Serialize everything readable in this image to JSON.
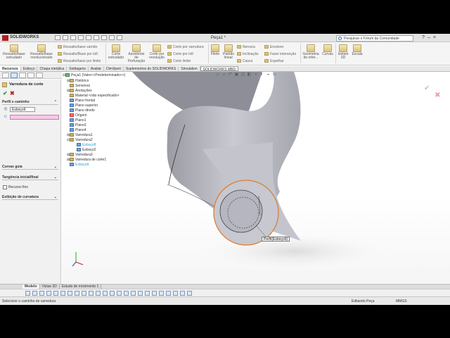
{
  "app": {
    "brand": "SOLIDWORKS",
    "brand_prefix": "3DS",
    "doc_title": "Peça1 *",
    "search_placeholder": "Pesquisar o Fórum da Comunidade"
  },
  "ribbon": {
    "big_buttons": [
      {
        "label": "Ressalto/base extrudado"
      },
      {
        "label": "Ressalto/base revolucionado"
      },
      {
        "label": "Corte extrudado"
      },
      {
        "label": "Assistente de Perfuração"
      },
      {
        "label": "Corte por revolução"
      },
      {
        "label": "Filete"
      },
      {
        "label": "Padrão linear"
      },
      {
        "label": "Nervura"
      },
      {
        "label": "Geometria de refer..."
      },
      {
        "label": "Curvas"
      },
      {
        "label": "Instant 3D"
      },
      {
        "label": "Escala"
      }
    ],
    "small_buttons": [
      {
        "label": "Ressalto/base varrido"
      },
      {
        "label": "Ressalto/Base por loft"
      },
      {
        "label": "Ressalto/base por limite"
      },
      {
        "label": "Corte por varredura"
      },
      {
        "label": "Corte por loft"
      },
      {
        "label": "Corte limite"
      },
      {
        "label": "Inclinação"
      },
      {
        "label": "Casca"
      },
      {
        "label": "Envolver"
      },
      {
        "label": "Fazer interseção"
      },
      {
        "label": "Espelhar"
      }
    ]
  },
  "command_tabs": [
    "Recursos",
    "Esboço",
    "Chapa metálica",
    "Soldagens",
    "Avaliar",
    "DimXpert",
    "Suplementos do SOLIDWORKS",
    "Simulation",
    "SOLIDWORKS MBD"
  ],
  "property_manager": {
    "title": "Varredura de corte",
    "profile_group": "Perfil e caminho",
    "profile_value": "Esboço9",
    "path_value": "",
    "guide_curves_group": "Curvas guia",
    "tangency_group": "Tangência inicial/final",
    "thin_feature_label": "Recurso fino",
    "curvature_group": "Exibição de curvatura"
  },
  "feature_tree": {
    "root": "Peça1  (Valor<<Predeterminado>>)",
    "items": [
      {
        "label": "Histórico",
        "indent": 1
      },
      {
        "label": "Sensores",
        "indent": 1
      },
      {
        "label": "Anotações",
        "indent": 1
      },
      {
        "label": "Material <não especificado>",
        "indent": 1
      },
      {
        "label": "Plano frontal",
        "indent": 1
      },
      {
        "label": "Plano superior",
        "indent": 1
      },
      {
        "label": "Plano direito",
        "indent": 1
      },
      {
        "label": "Origem",
        "indent": 1
      },
      {
        "label": "Plano1",
        "indent": 1
      },
      {
        "label": "Plano3",
        "indent": 1
      },
      {
        "label": "Plano4",
        "indent": 1
      },
      {
        "label": "Varredura1",
        "indent": 1
      },
      {
        "label": "Varredura2",
        "indent": 1
      },
      {
        "label": "Esboço8",
        "indent": 2
      },
      {
        "label": "Esboço2",
        "indent": 2
      },
      {
        "label": "Varredura3",
        "indent": 1
      },
      {
        "label": "Varredura de corte1",
        "indent": 1
      },
      {
        "label": "Esboço9",
        "indent": 1
      }
    ]
  },
  "graphics": {
    "callout_label": "Perfil(Esboço9)"
  },
  "bottom_tabs": [
    "Modelo",
    "Vistas 3D",
    "Estudo de movimento 1"
  ],
  "status": {
    "message": "Selecione o caminho de varredura",
    "mode": "Editando Peça",
    "units": "MMGS"
  }
}
